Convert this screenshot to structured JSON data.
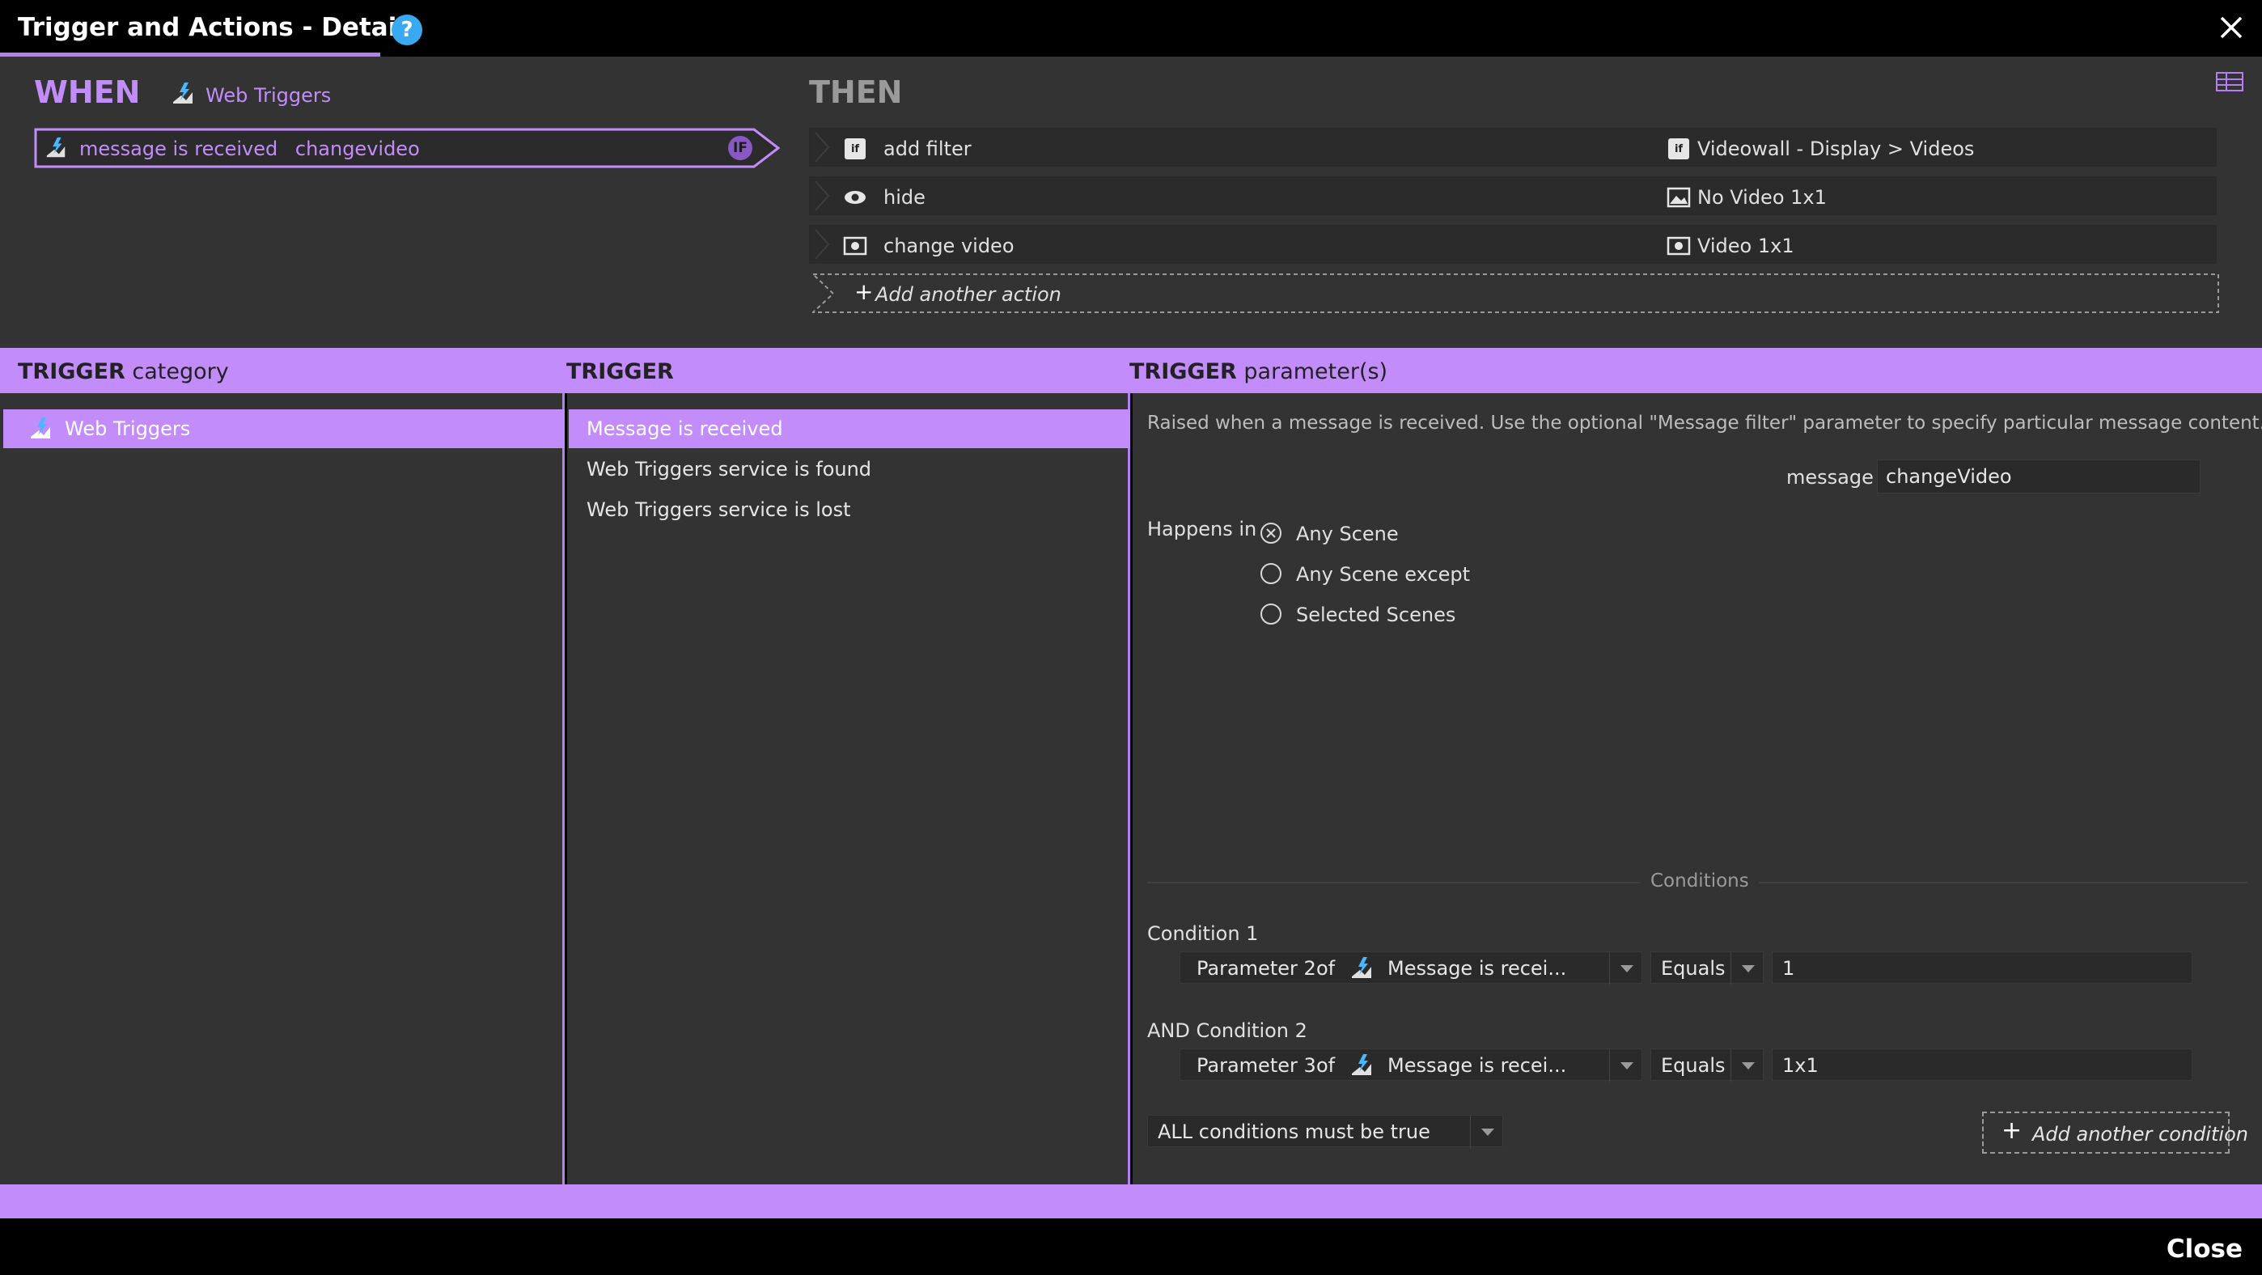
{
  "window": {
    "title": "Trigger and Actions - Details",
    "help_glyph": "?"
  },
  "when": {
    "label": "WHEN",
    "category": "Web Triggers",
    "trigger_name": "message is received",
    "trigger_value": "changevideo",
    "badge": "IF"
  },
  "then": {
    "label": "THEN",
    "actions": [
      {
        "label": "add filter",
        "icon": "if-filter-icon",
        "target": "Videowall - Display > Videos",
        "target_icon": "if-filter-icon"
      },
      {
        "label": "hide",
        "icon": "eye-icon",
        "target": "No Video 1x1",
        "target_icon": "image-icon"
      },
      {
        "label": "change video",
        "icon": "video-icon",
        "target": "Video 1x1",
        "target_icon": "video-icon"
      }
    ],
    "add_action": "Add another action"
  },
  "headers": {
    "category_bold": "TRIGGER",
    "category_rest": "category",
    "trigger_bold": "TRIGGER",
    "params_bold": "TRIGGER",
    "params_rest": "parameter(s)"
  },
  "categories": [
    {
      "label": "Web Triggers",
      "selected": true
    }
  ],
  "triggers": [
    {
      "label": "Message is received",
      "selected": true
    },
    {
      "label": "Web Triggers service is found",
      "selected": false
    },
    {
      "label": "Web Triggers service is lost",
      "selected": false
    }
  ],
  "params": {
    "description": "Raised when a message is received. Use the optional \"Message filter\" parameter to specify particular message content.",
    "message_label": "message",
    "message_value": "changeVideo",
    "happens_in_label": "Happens in",
    "scene_options": [
      {
        "label": "Any Scene",
        "selected": true
      },
      {
        "label": "Any Scene except",
        "selected": false
      },
      {
        "label": "Selected Scenes",
        "selected": false
      }
    ]
  },
  "conditions": {
    "title": "Conditions",
    "items": [
      {
        "label": "Condition 1",
        "param": "Parameter 2",
        "of": "of",
        "source": "Message is recei...",
        "operator": "Equals",
        "value": "1"
      },
      {
        "label": "AND Condition 2",
        "param": "Parameter 3",
        "of": "of",
        "source": "Message is recei...",
        "operator": "Equals",
        "value": "1x1"
      }
    ],
    "mode": "ALL conditions must be true",
    "add_condition": "Add another condition"
  },
  "footer": {
    "close_label": "Close"
  },
  "colors": {
    "accent": "#c38cfb",
    "panel": "#333333",
    "chrome": "#000000",
    "help": "#39a9f2"
  }
}
